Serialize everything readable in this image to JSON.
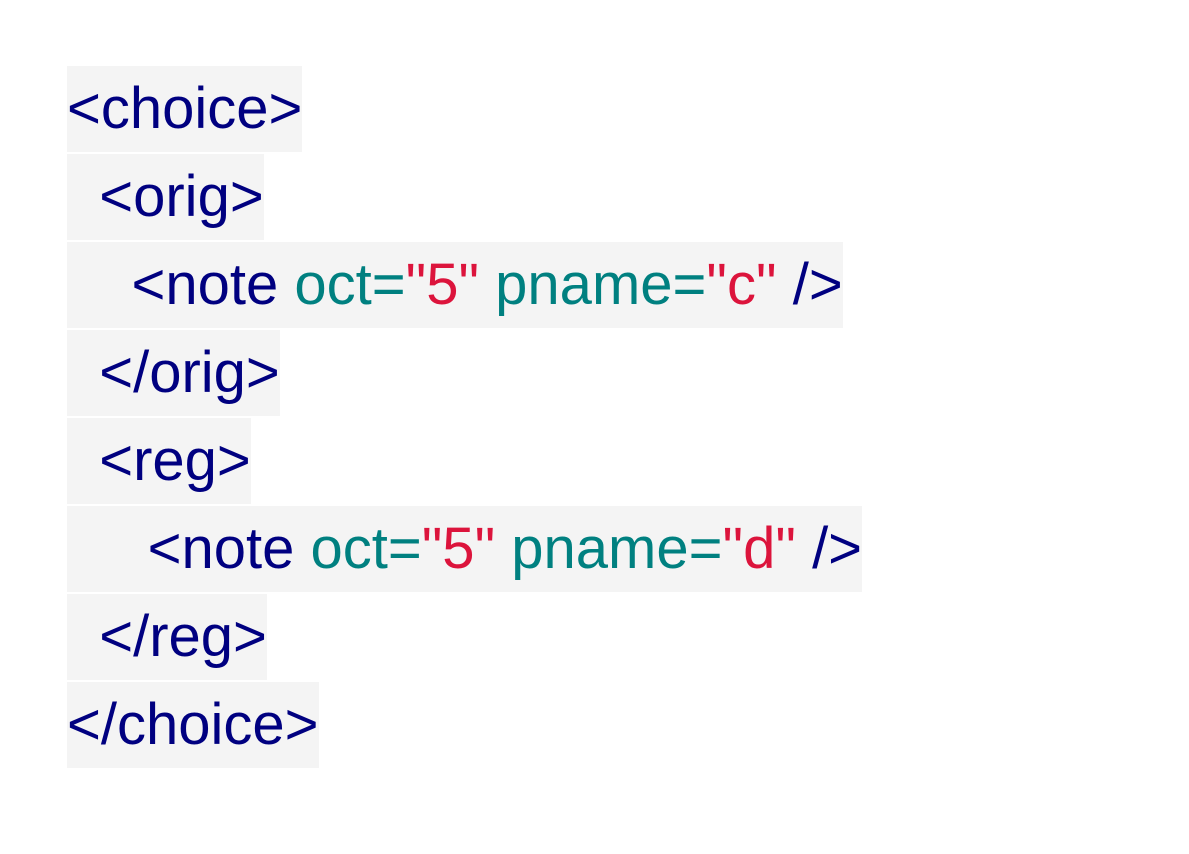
{
  "colors": {
    "tag": "#000080",
    "attribute": "#008080",
    "value": "#dc143c",
    "line_background": "#f4f4f4"
  },
  "lines": [
    {
      "indent": "",
      "open": "<choice>"
    },
    {
      "indent": "  ",
      "open": "<orig>"
    },
    {
      "indent": "    ",
      "open": "<note",
      "attr1": "oct=",
      "val1": "\"5\"",
      "attr2": "pname=",
      "val2": "\"c\"",
      "close": "/>"
    },
    {
      "indent": "  ",
      "open": "</orig>"
    },
    {
      "indent": "  ",
      "open": "<reg>"
    },
    {
      "indent": "     ",
      "open": "<note",
      "attr1": "oct=",
      "val1": "\"5\"",
      "attr2": "pname=",
      "val2": "\"d\"",
      "close": "/>"
    },
    {
      "indent": "  ",
      "open": "</reg>"
    },
    {
      "indent": "",
      "open": "</choice>"
    }
  ]
}
